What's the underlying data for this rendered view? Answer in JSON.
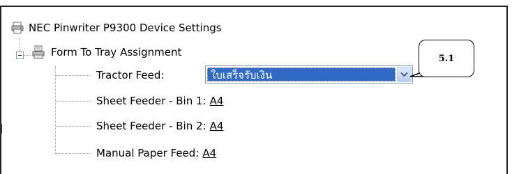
{
  "tree": {
    "root": {
      "icon": "printer-icon",
      "label": "NEC Pinwriter P9300 Device Settings"
    },
    "group": {
      "expander_icon": "collapse-minus-icon",
      "icon": "printer-tray-icon",
      "label": "Form To Tray Assignment"
    },
    "items": [
      {
        "label": "Tractor Feed:",
        "value": "ใบเสร็จรับเงิน",
        "control": "dropdown"
      },
      {
        "label": "Sheet Feeder - Bin 1:",
        "value": "A4"
      },
      {
        "label": "Sheet Feeder - Bin 2:",
        "value": "A4"
      },
      {
        "label": "Manual Paper Feed:",
        "value": "A4"
      }
    ]
  },
  "dropdown": {
    "selected": "ใบเสร็จรับเงิน",
    "arrow_icon": "chevron-down-icon"
  },
  "annotation": {
    "label": "5.1"
  },
  "colors": {
    "selection": "#316ac5",
    "tree_line": "#9a9a9a",
    "combo_border": "#7f9db9"
  }
}
